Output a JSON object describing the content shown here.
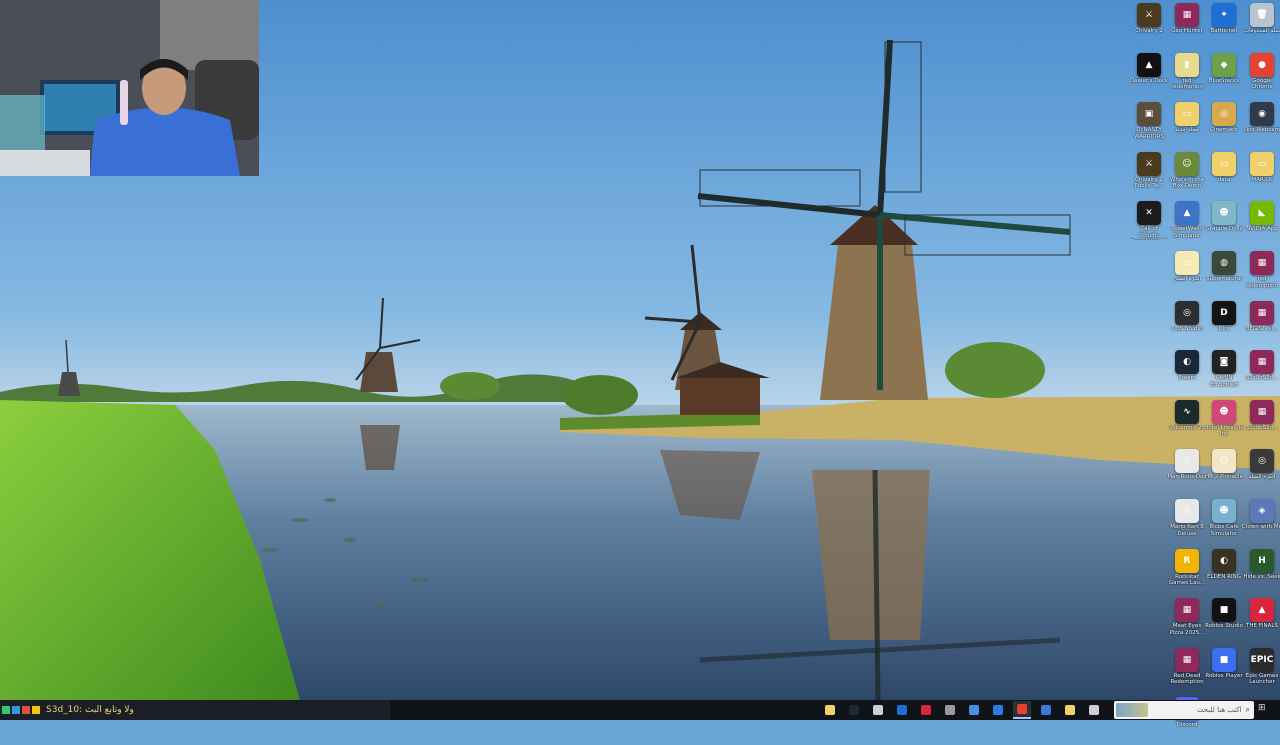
{
  "desktop": {
    "icons": [
      {
        "label": "Chivalry 2",
        "glyph": "⚔",
        "color": "#4a3a1e"
      },
      {
        "label": "Geo Hunter",
        "glyph": "▦",
        "color": "#8e2a5a"
      },
      {
        "label": "Battle.net",
        "glyph": "✦",
        "color": "#1d6fd6"
      },
      {
        "label": "سلة المحذوفات",
        "glyph": "🗑",
        "color": "#b9c4cf"
      },
      {
        "label": "Dealer's Deck",
        "glyph": "▲",
        "color": "#111111"
      },
      {
        "label": "red redemption",
        "glyph": "▮",
        "color": "#e9d98c"
      },
      {
        "label": "BlueStacks",
        "glyph": "◆",
        "color": "#6ea04a"
      },
      {
        "label": "Google Chrome",
        "glyph": "●",
        "color": "#e44332"
      },
      {
        "label": "DYNASTY WARRIORS",
        "glyph": "▣",
        "color": "#5a4e3a"
      },
      {
        "label": "مجلد جديد",
        "glyph": "▭",
        "color": "#f1cf6a"
      },
      {
        "label": "Cinematic",
        "glyph": "◎",
        "color": "#d7a84e"
      },
      {
        "label": "Nox Webcam",
        "glyph": "◉",
        "color": "#2f3a4a"
      },
      {
        "label": "Chivalry 2 Public Te...",
        "glyph": "⚔",
        "color": "#4a3a1e"
      },
      {
        "label": "Who's in the Box Demo",
        "glyph": "☺",
        "color": "#6a8a3a"
      },
      {
        "label": "data",
        "glyph": "▭",
        "color": "#f1cf6a"
      },
      {
        "label": "MAR.CK",
        "glyph": "▭",
        "color": "#f1cf6a"
      },
      {
        "label": "Call of Cthulhu Expedition 33",
        "glyph": "✕",
        "color": "#1b1b1b"
      },
      {
        "label": "PowerWash Simulator",
        "glyph": "▲",
        "color": "#3d73c8"
      },
      {
        "label": "Grapple Dolls",
        "glyph": "☻",
        "color": "#7fb7c9"
      },
      {
        "label": "NVIDIA App",
        "glyph": "◣",
        "color": "#76b900"
      },
      {
        "label": "الكرة اليمنى",
        "glyph": "▭",
        "color": "#f6e9b2"
      },
      {
        "label": "Supernatural",
        "glyph": "◍",
        "color": "#3b4a38"
      },
      {
        "label": "red redemption",
        "glyph": "▦",
        "color": "#8e2a5a"
      },
      {
        "label": "OBS Studio",
        "glyph": "◎",
        "color": "#2e2e2e"
      },
      {
        "label": "Dire",
        "glyph": "D",
        "color": "#141414"
      },
      {
        "label": "BFGIST_vi...",
        "glyph": "▦",
        "color": "#8e2a5a"
      },
      {
        "label": "Steam",
        "glyph": "◐",
        "color": "#1b2838"
      },
      {
        "label": "CABIN Embodied",
        "glyph": "◙",
        "color": "#222222"
      },
      {
        "label": "32c9b52d...",
        "glyph": "▦",
        "color": "#8e2a5a"
      },
      {
        "label": "Voicemod V3",
        "glyph": "∿",
        "color": "#1b2a2a"
      },
      {
        "label": "Hotel Lifestyle Inc",
        "glyph": "☻",
        "color": "#d04878"
      },
      {
        "label": "32c9b52d...",
        "glyph": "▦",
        "color": "#8e2a5a"
      },
      {
        "label": "Man Runs Day",
        "glyph": "▯",
        "color": "#e8e8e8"
      },
      {
        "label": "HR 2 Pinnacle",
        "glyph": "☺",
        "color": "#f3e6c8"
      },
      {
        "label": "الكرة السلة",
        "glyph": "◎",
        "color": "#3a3a3a"
      },
      {
        "label": "Mario Kart 8 Deluxe",
        "glyph": "▯",
        "color": "#e8e8e8"
      },
      {
        "label": "Blobs Cafe Simulator",
        "glyph": "☻",
        "color": "#7ab0d0"
      },
      {
        "label": "Clown with Me",
        "glyph": "◈",
        "color": "#5a7ab8"
      },
      {
        "label": "Rockstar Games Lau...",
        "glyph": "R",
        "color": "#f2b400"
      },
      {
        "label": "ELDEN RING",
        "glyph": "◐",
        "color": "#3a3220"
      },
      {
        "label": "Hide vs. Seek",
        "glyph": "H",
        "color": "#2a5a2a"
      },
      {
        "label": "Meat Eyes Pizza 2025...",
        "glyph": "▦",
        "color": "#8e2a5a"
      },
      {
        "label": "Roblox Studio",
        "glyph": "■",
        "color": "#111111"
      },
      {
        "label": "THE FINALS",
        "glyph": "▲",
        "color": "#d7263d"
      },
      {
        "label": "Red Dead Redemption",
        "glyph": "▦",
        "color": "#8e2a5a"
      },
      {
        "label": "Roblox Player",
        "glyph": "■",
        "color": "#3a6ff0"
      },
      {
        "label": "Epic Games Launcher",
        "glyph": "EPIC",
        "color": "#2b2b2b"
      },
      {
        "label": "Discord",
        "glyph": "◕",
        "color": "#5865f2"
      }
    ]
  },
  "taskbar": {
    "ticker_text": "S3d_10: ولا وتابع البث",
    "search_placeholder": "اكتب هنا للبحث",
    "apps": [
      {
        "name": "file-explorer-icon",
        "color": "#f1cf6a",
        "active": false
      },
      {
        "name": "steam-icon",
        "color": "#1b2838",
        "active": false
      },
      {
        "name": "settings-icon",
        "color": "#cfcfcf",
        "active": false
      },
      {
        "name": "battlenet-icon",
        "color": "#1d6fd6",
        "active": false
      },
      {
        "name": "record-icon",
        "color": "#d7263d",
        "active": false
      },
      {
        "name": "obs-icon",
        "color": "#9a9a9a",
        "active": false
      },
      {
        "name": "app-icon",
        "color": "#4a90e2",
        "active": false
      },
      {
        "name": "edge-icon",
        "color": "#2b7de0",
        "active": false
      },
      {
        "name": "chrome-icon",
        "color": "#e44332",
        "active": true
      },
      {
        "name": "store-icon",
        "color": "#3a7bd5",
        "active": false
      },
      {
        "name": "folder-icon",
        "color": "#f1cf6a",
        "active": false
      },
      {
        "name": "taskview-icon",
        "color": "#cfcfcf",
        "active": false
      }
    ]
  }
}
